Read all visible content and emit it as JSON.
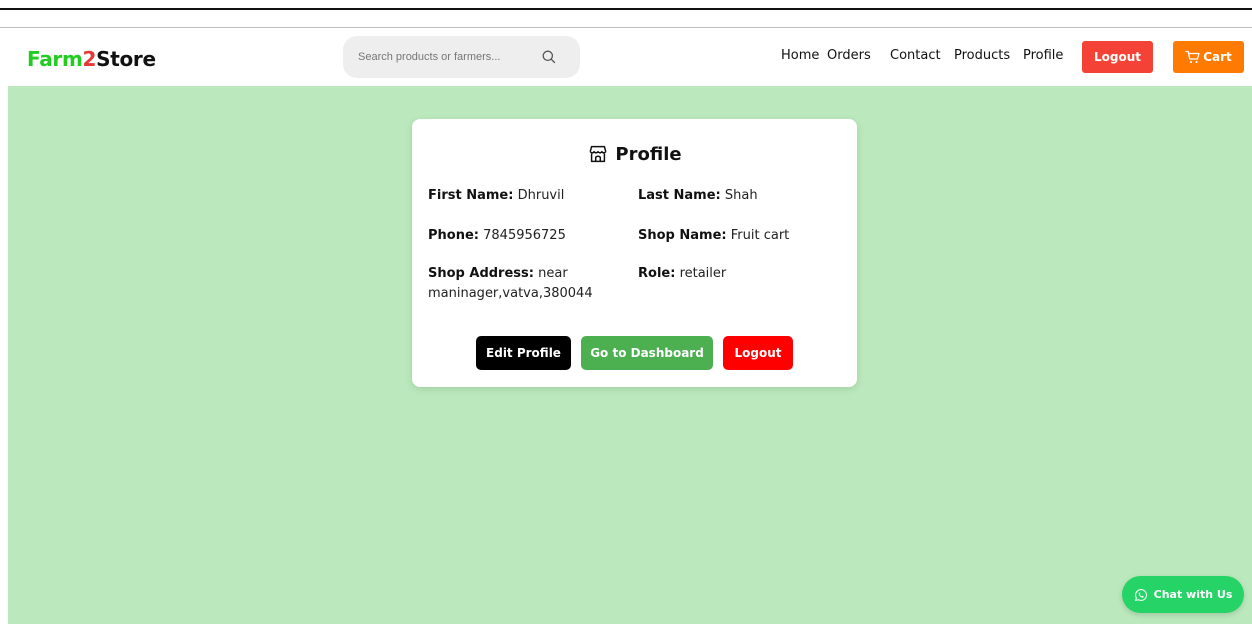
{
  "brand": {
    "part1": "Farm",
    "part2": "2",
    "part3": "Store"
  },
  "search": {
    "placeholder": "Search products or farmers...",
    "icon": "search-icon"
  },
  "nav": {
    "links": [
      "Home",
      "Orders",
      "Contact",
      "Products",
      "Profile"
    ],
    "logout_label": "Logout",
    "cart_label": "Cart"
  },
  "profile": {
    "title": "Profile",
    "icon": "store-icon",
    "fields": [
      {
        "label": "First Name:",
        "value": "Dhruvil"
      },
      {
        "label": "Last Name:",
        "value": "Shah"
      },
      {
        "label": "Phone:",
        "value": "7845956725"
      },
      {
        "label": "Shop Name:",
        "value": "Fruit cart"
      },
      {
        "label": "Shop Address:",
        "value": "near maninager,vatva,380044"
      },
      {
        "label": "Role:",
        "value": "retailer"
      }
    ],
    "buttons": {
      "edit": "Edit Profile",
      "dashboard": "Go to Dashboard",
      "logout": "Logout"
    }
  },
  "chat": {
    "label": "Chat with Us",
    "icon": "whatsapp-icon"
  },
  "colors": {
    "brand_green": "#22cc22",
    "brand_red": "#e53935",
    "page_background": "#bbe9bd",
    "logout_top": "#f44336",
    "cart": "#ff7a00",
    "dashboard": "#4caf50",
    "logout_card": "#ff0000",
    "chat": "#25d366"
  }
}
